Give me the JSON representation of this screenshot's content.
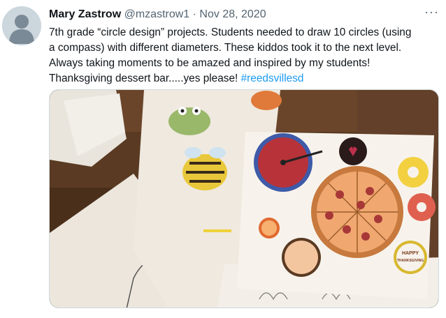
{
  "author": {
    "name": "Mary Zastrow",
    "handle": "@mzastrow1",
    "separator": "·",
    "date": "Nov 28, 2020"
  },
  "more_icon": "···",
  "tweet": {
    "lines": [
      "7th grade “circle design” projects. Students needed to draw 10 circles (using",
      "a compass) with different diameters. These kiddos took it to the next level.",
      "Always taking moments to be amazed and inspired by my students!",
      "Thanksgiving dessert bar.....yes please! "
    ],
    "hashtag": "#reedsvillesd"
  },
  "photo": {
    "happy_text": "HAPPY",
    "thanksgiving_text": "THANKSGIVING"
  },
  "colors": {
    "hashtag": "#1d9bf0",
    "secondary_text": "#536471"
  }
}
